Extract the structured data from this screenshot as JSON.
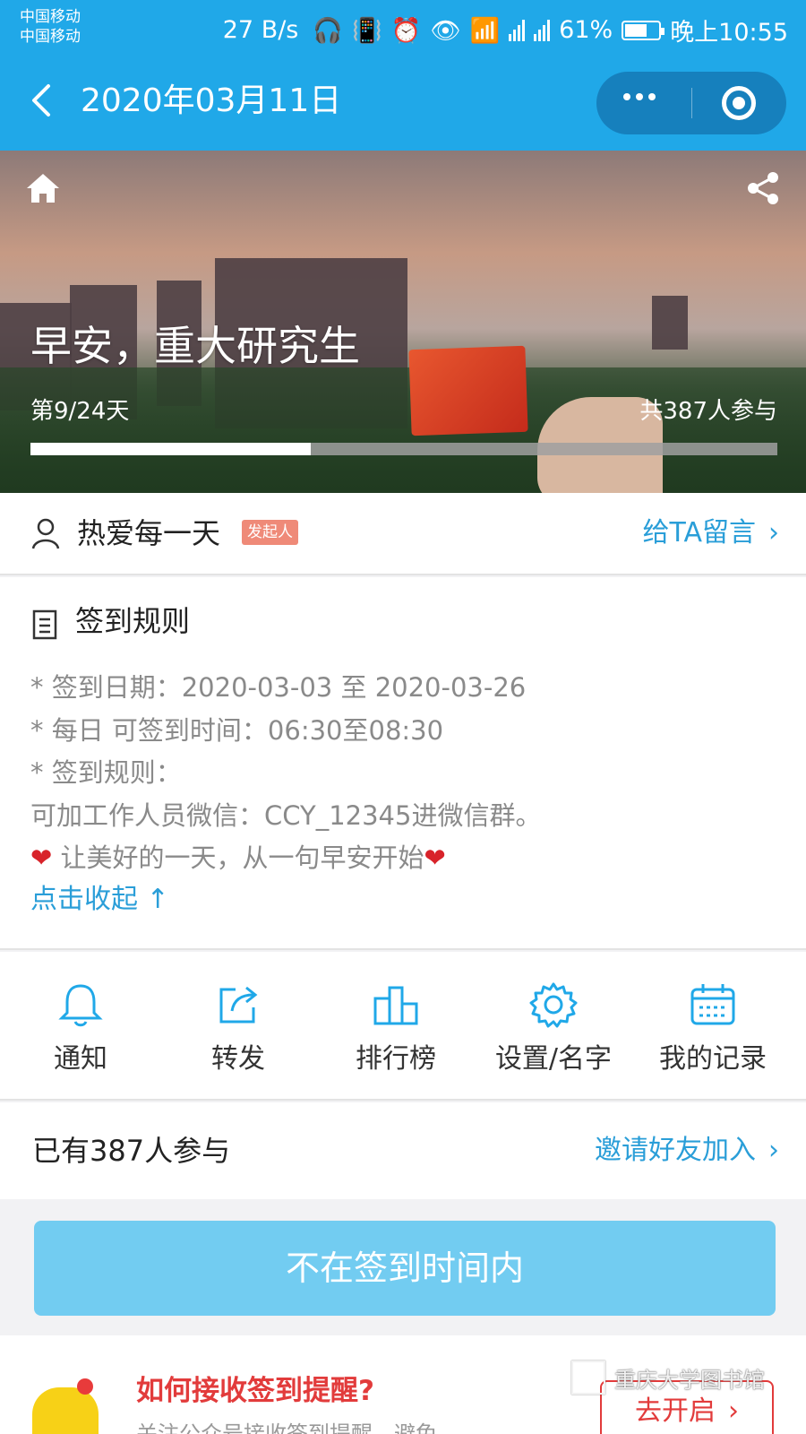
{
  "status_bar": {
    "carrier_1": "中国移动",
    "carrier_2": "中国移动",
    "speed": "27 B/s",
    "battery": "61%",
    "time": "晚上10:55"
  },
  "nav": {
    "title": "2020年03月11日"
  },
  "hero": {
    "headline": "早安，重大研究生",
    "day_progress": "第9/24天",
    "participants": "共387人参与",
    "progress": {
      "current": 9,
      "total": 24
    }
  },
  "initiator": {
    "name": "热爱每一天",
    "badge": "发起人",
    "message_link": "给TA留言"
  },
  "rules": {
    "heading": "签到规则",
    "lines": [
      "* 签到日期：2020-03-03 至 2020-03-26",
      "* 每日 可签到时间：06:30至08:30",
      "* 签到规则：",
      "可加工作人员微信：CCY_12345进微信群。"
    ],
    "slogan": "让美好的一天，从一句早安开始",
    "heart": "❤",
    "collapse": "点击收起 ↑"
  },
  "actions": [
    {
      "label": "通知",
      "icon": "bell-icon"
    },
    {
      "label": "转发",
      "icon": "share-arrow-icon"
    },
    {
      "label": "排行榜",
      "icon": "podium-icon"
    },
    {
      "label": "设置/名字",
      "icon": "gear-icon"
    },
    {
      "label": "我的记录",
      "icon": "calendar-icon"
    }
  ],
  "participants": {
    "text": "已有387人参与",
    "invite": "邀请好友加入"
  },
  "signin_button": "不在签到时间内",
  "reminder": {
    "title": "如何接收签到提醒?",
    "subtitle": "关注公众号接收签到提醒，避免",
    "button": "去开启"
  },
  "watermark": "重庆大学图书馆",
  "colors": {
    "primary": "#20a8e8",
    "link": "#2a9ed8",
    "button": "#72ccf1",
    "alert": "#e23b3b",
    "badge": "#ef8a78"
  }
}
